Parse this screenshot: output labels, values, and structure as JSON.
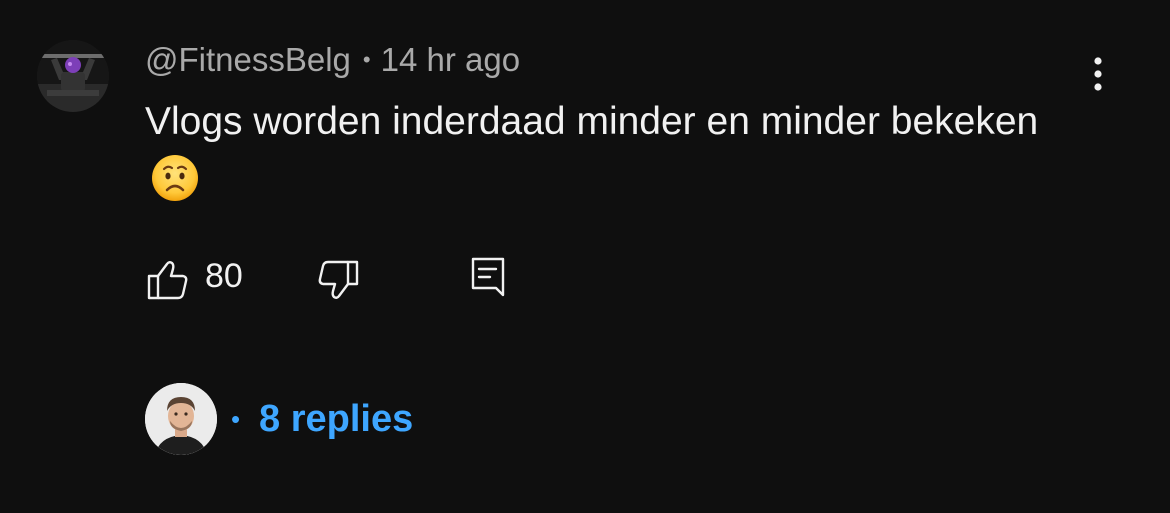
{
  "comment": {
    "author": "@FitnessBelg",
    "separator": "•",
    "timestamp": "14 hr ago",
    "text": "Vlogs worden inderdaad minder en minder bekeken",
    "emoji": "worried-face",
    "like_count": "80"
  },
  "replies": {
    "separator": "•",
    "label": "8 replies"
  },
  "colors": {
    "background": "#0f0f0f",
    "text": "#f1f1f1",
    "meta": "#a9a9a9",
    "link": "#3ea6ff"
  },
  "icons": {
    "menu": "more-vertical-icon",
    "like": "thumbs-up-icon",
    "dislike": "thumbs-down-icon",
    "reply": "reply-comment-icon"
  }
}
